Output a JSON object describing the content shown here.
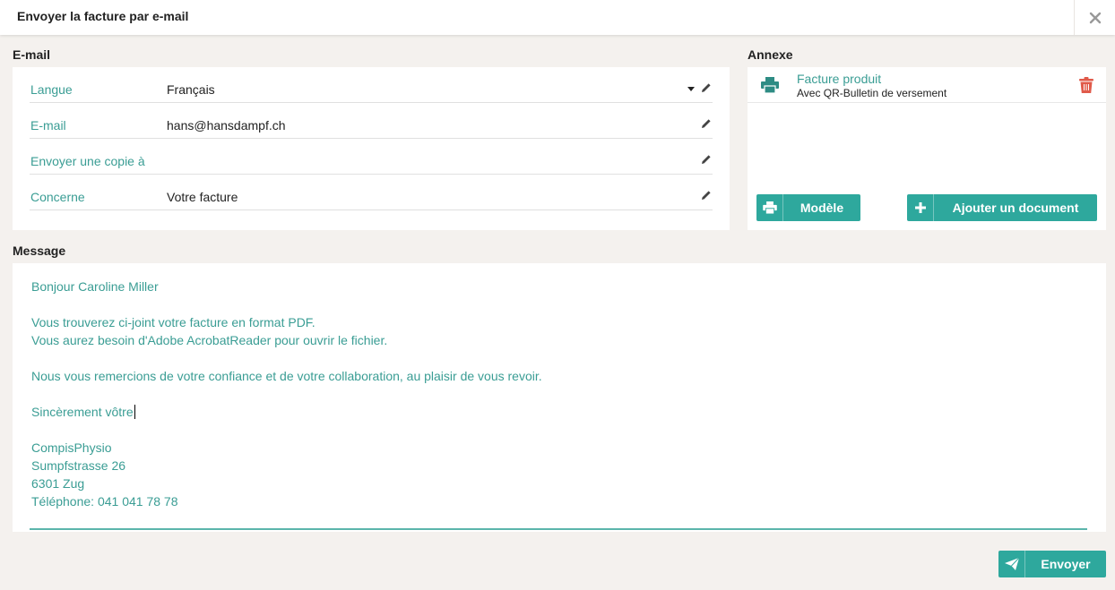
{
  "dialog": {
    "title": "Envoyer la facture par e-mail",
    "close_icon": "close-icon"
  },
  "email_section": {
    "title": "E-mail",
    "fields": [
      {
        "label": "Langue",
        "value": "Français",
        "type": "select"
      },
      {
        "label": "E-mail",
        "value": "hans@hansdampf.ch",
        "type": "text"
      },
      {
        "label": "Envoyer une copie à",
        "value": "",
        "type": "text"
      },
      {
        "label": "Concerne",
        "value": "Votre facture",
        "type": "text"
      }
    ]
  },
  "annex_section": {
    "title": "Annexe",
    "attachment": {
      "name": "Facture produit",
      "subtitle": "Avec QR-Bulletin de versement"
    },
    "template_button": "Modèle",
    "add_document_button": "Ajouter un document"
  },
  "message_section": {
    "title": "Message",
    "lines": [
      "Bonjour Caroline Miller",
      "",
      "Vous trouverez ci-joint votre facture en format PDF.",
      "Vous aurez besoin d'Adobe AcrobatReader pour ouvrir le fichier.",
      "",
      "Nous vous remercions de votre confiance et de votre collaboration, au plaisir de vous revoir.",
      "",
      "Sincèrement vôtre",
      "",
      "CompisPhysio",
      "Sumpfstrasse 26",
      "6301 Zug",
      "Téléphone: 041 041 78 78"
    ]
  },
  "send_button": "Envoyer",
  "colors": {
    "accent": "#2ea89d",
    "label_text": "#3a9d94",
    "delete": "#e05a4a",
    "background": "#f4f1ee"
  }
}
